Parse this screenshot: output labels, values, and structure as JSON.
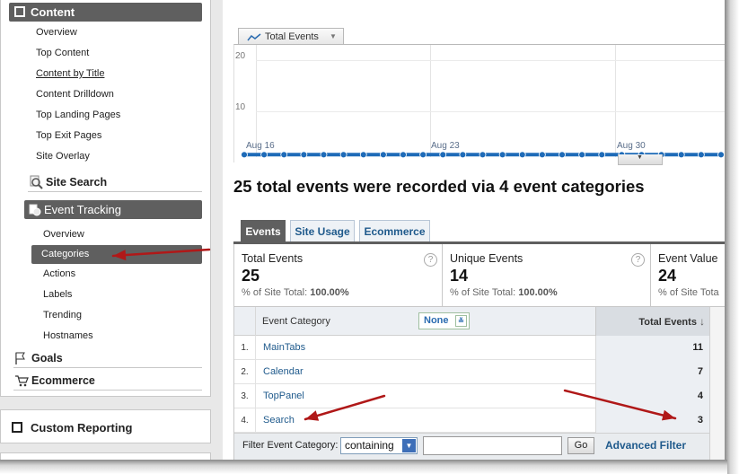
{
  "sidebar": {
    "content_header": "Content",
    "content_items": [
      "Overview",
      "Top Content",
      "Content by Title",
      "Content Drilldown",
      "Top Landing Pages",
      "Top Exit Pages",
      "Site Overlay"
    ],
    "site_search": "Site Search",
    "event_tracking_header": "Event Tracking",
    "event_items": [
      "Overview",
      "Categories",
      "Actions",
      "Labels",
      "Trending",
      "Hostnames"
    ],
    "goals": "Goals",
    "ecommerce": "Ecommerce",
    "custom_reporting": "Custom Reporting"
  },
  "chart": {
    "selector_label": "Total Events",
    "y_ticks": [
      "20",
      "10"
    ],
    "x_labels": [
      "Aug 16",
      "Aug 23",
      "Aug 30"
    ]
  },
  "chart_data": {
    "type": "line",
    "series": [
      {
        "name": "Total Events",
        "values": [
          1,
          1,
          1,
          1,
          1,
          1,
          1,
          1,
          1,
          1,
          1,
          1,
          1,
          1,
          1,
          1,
          1,
          1,
          1,
          1,
          1,
          1,
          1,
          1,
          1
        ]
      }
    ],
    "ylim": [
      0,
      20
    ]
  },
  "headline": "25 total events were recorded via 4 event categories",
  "tabs": [
    "Events",
    "Site Usage",
    "Ecommerce"
  ],
  "metrics": [
    {
      "label": "Total Events",
      "value": "25",
      "pct_label": "% of Site Total:",
      "pct_value": "100.00%"
    },
    {
      "label": "Unique Events",
      "value": "14",
      "pct_label": "% of Site Total:",
      "pct_value": "100.00%"
    },
    {
      "label": "Event Value",
      "value": "24",
      "pct_label": "% of Site Tota",
      "pct_value": ""
    }
  ],
  "table": {
    "col_category": "Event Category",
    "secondary_dim": "None",
    "col_total": "Total Events",
    "rows": [
      {
        "num": "1.",
        "category": "MainTabs",
        "total": "11"
      },
      {
        "num": "2.",
        "category": "Calendar",
        "total": "7"
      },
      {
        "num": "3.",
        "category": "TopPanel",
        "total": "4"
      },
      {
        "num": "4.",
        "category": "Search",
        "total": "3"
      }
    ]
  },
  "filter": {
    "label": "Filter Event Category:",
    "mode": "containing",
    "value": "",
    "go": "Go",
    "advanced": "Advanced Filter"
  },
  "annotation_color": "#b01818"
}
